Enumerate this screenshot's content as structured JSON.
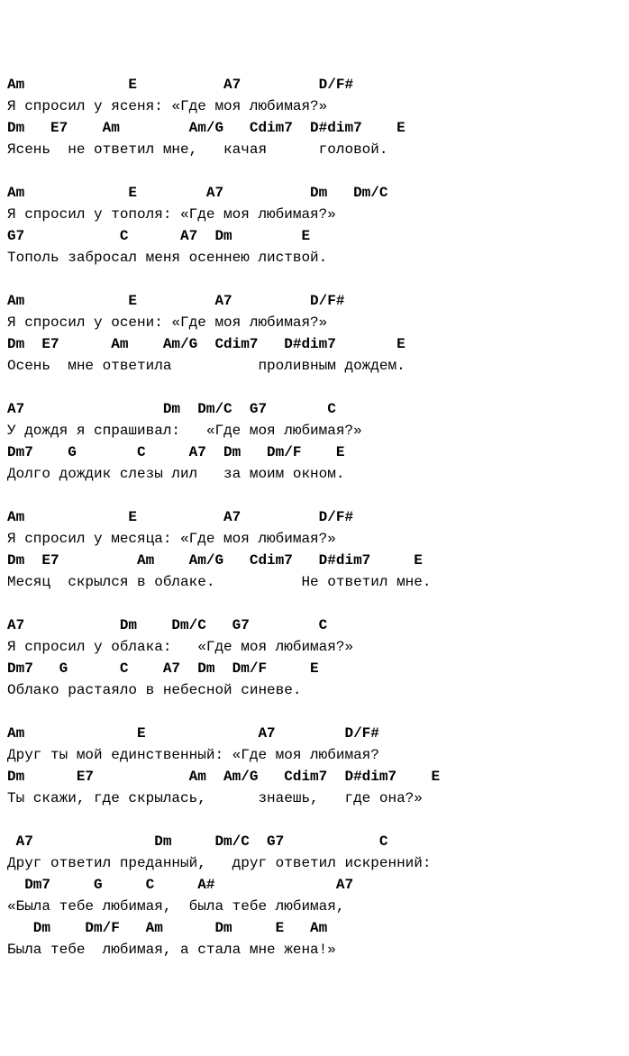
{
  "stanzas": [
    {
      "lines": [
        {
          "type": "chord",
          "text": "Am            E          A7         D/F#"
        },
        {
          "type": "lyric",
          "text": "Я спросил у ясеня: «Где моя любимая?»"
        },
        {
          "type": "chord",
          "text": "Dm   E7    Am        Am/G   Cdim7  D#dim7    E"
        },
        {
          "type": "lyric",
          "text": "Ясень  не ответил мне,   качая      головой."
        }
      ]
    },
    {
      "lines": [
        {
          "type": "chord",
          "text": "Am            E        A7          Dm   Dm/C"
        },
        {
          "type": "lyric",
          "text": "Я спросил у тополя: «Где моя любимая?»"
        },
        {
          "type": "chord",
          "text": "G7           C      A7  Dm        E"
        },
        {
          "type": "lyric",
          "text": "Тополь забросал меня осеннею листвой."
        }
      ]
    },
    {
      "lines": [
        {
          "type": "chord",
          "text": "Am            E         A7         D/F#"
        },
        {
          "type": "lyric",
          "text": "Я спросил у осени: «Где моя любимая?»"
        },
        {
          "type": "chord",
          "text": "Dm  E7      Am    Am/G  Cdim7   D#dim7       E"
        },
        {
          "type": "lyric",
          "text": "Осень  мне ответила          проливным дождем."
        }
      ]
    },
    {
      "lines": [
        {
          "type": "chord",
          "text": "A7                Dm  Dm/C  G7       C"
        },
        {
          "type": "lyric",
          "text": "У дождя я спрашивал:   «Где моя любимая?»"
        },
        {
          "type": "chord",
          "text": "Dm7    G       C     A7  Dm   Dm/F    E"
        },
        {
          "type": "lyric",
          "text": "Долго дождик слезы лил   за моим окном."
        }
      ]
    },
    {
      "lines": [
        {
          "type": "chord",
          "text": "Am            E          A7         D/F#"
        },
        {
          "type": "lyric",
          "text": "Я спросил у месяца: «Где моя любимая?»"
        },
        {
          "type": "chord",
          "text": "Dm  E7         Am    Am/G   Cdim7   D#dim7     E"
        },
        {
          "type": "lyric",
          "text": "Месяц  скрылся в облаке.          Не ответил мне."
        }
      ]
    },
    {
      "lines": [
        {
          "type": "chord",
          "text": "A7           Dm    Dm/C   G7        C"
        },
        {
          "type": "lyric",
          "text": "Я спросил у облака:   «Где моя любимая?»"
        },
        {
          "type": "chord",
          "text": "Dm7   G      C    A7  Dm  Dm/F     E"
        },
        {
          "type": "lyric",
          "text": "Облако растаяло в небесной синеве."
        }
      ]
    },
    {
      "lines": [
        {
          "type": "chord",
          "text": "Am             E             A7        D/F#"
        },
        {
          "type": "lyric",
          "text": "Друг ты мой единственный: «Где моя любимая?"
        },
        {
          "type": "chord",
          "text": "Dm      E7           Am  Am/G   Cdim7  D#dim7    E"
        },
        {
          "type": "lyric",
          "text": "Ты скажи, где скрылась,      знаешь,   где она?»"
        }
      ]
    },
    {
      "lines": [
        {
          "type": "chord",
          "text": " A7              Dm     Dm/C  G7           C"
        },
        {
          "type": "lyric",
          "text": "Друг ответил преданный,   друг ответил искренний:"
        },
        {
          "type": "chord",
          "text": "  Dm7     G     C     A#              A7"
        },
        {
          "type": "lyric",
          "text": "«Была тебе любимая,  была тебе любимая,"
        },
        {
          "type": "chord",
          "text": "   Dm    Dm/F   Am      Dm     E   Am"
        },
        {
          "type": "lyric",
          "text": "Была тебе  любимая, а стала мне жена!»"
        }
      ]
    }
  ]
}
